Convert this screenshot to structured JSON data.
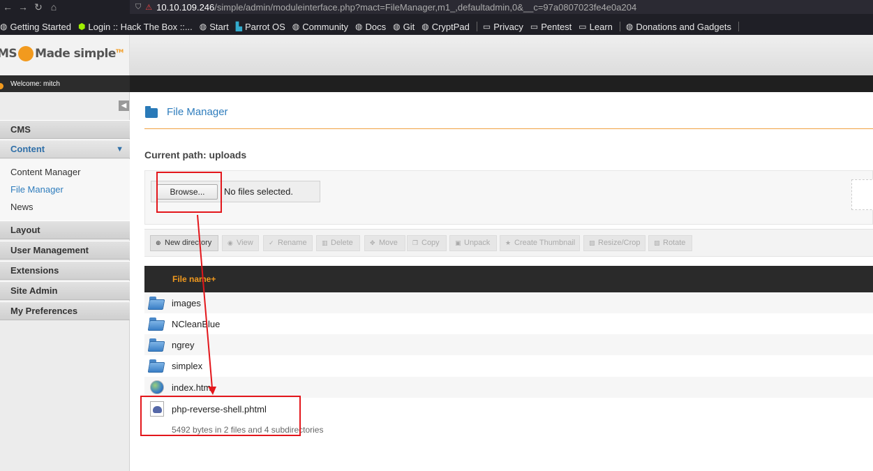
{
  "browser": {
    "url_host": "10.10.109.246",
    "url_path": "/simple/admin/moduleinterface.php?mact=FileManager,m1_,defaultadmin,0&__c=97a0807023fe4e0a204",
    "bookmarks": [
      {
        "label": "Getting Started",
        "icon": "globe-icon"
      },
      {
        "label": "Login :: Hack The Box ::...",
        "icon": "htb-cube-icon"
      },
      {
        "label": "Start",
        "icon": "globe-icon"
      },
      {
        "label": "Parrot OS",
        "icon": "parrot-icon"
      },
      {
        "label": "Community",
        "icon": "globe-icon"
      },
      {
        "label": "Docs",
        "icon": "globe-icon"
      },
      {
        "label": "Git",
        "icon": "globe-icon"
      },
      {
        "label": "CryptPad",
        "icon": "globe-icon"
      },
      {
        "label": "Privacy",
        "icon": "folder-icon"
      },
      {
        "label": "Pentest",
        "icon": "folder-icon"
      },
      {
        "label": "Learn",
        "icon": "folder-icon"
      },
      {
        "label": "Donations and Gadgets",
        "icon": "globe-icon"
      }
    ]
  },
  "header": {
    "logo_left": "MS",
    "logo_right": "Made simple",
    "tm": "TM",
    "welcome": "Welcome: mitch"
  },
  "sidebar": {
    "sections": [
      {
        "label": "CMS"
      },
      {
        "label": "Content"
      },
      {
        "label": "Layout"
      },
      {
        "label": "User Management"
      },
      {
        "label": "Extensions"
      },
      {
        "label": "Site Admin"
      },
      {
        "label": "My Preferences"
      }
    ],
    "content_items": [
      {
        "label": "Content Manager"
      },
      {
        "label": "File Manager"
      },
      {
        "label": "News"
      }
    ]
  },
  "main": {
    "title": "File Manager",
    "current_path": "Current path: uploads",
    "browse_label": "Browse...",
    "no_files": "No files selected.",
    "toolbar": [
      {
        "label": "New directory",
        "icon": "plus-circle-icon"
      },
      {
        "label": "View",
        "icon": "eye-icon"
      },
      {
        "label": "Rename",
        "icon": "check-icon"
      },
      {
        "label": "Delete",
        "icon": "trash-icon"
      },
      {
        "label": "Move",
        "icon": "move-icon"
      },
      {
        "label": "Copy",
        "icon": "copy-icon"
      },
      {
        "label": "Unpack",
        "icon": "unpack-icon"
      },
      {
        "label": "Create Thumbnail",
        "icon": "star-icon"
      },
      {
        "label": "Resize/Crop",
        "icon": "image-icon"
      },
      {
        "label": "Rotate",
        "icon": "rotate-icon"
      }
    ],
    "column_header": "File name+",
    "files": [
      {
        "name": "images",
        "type": "folder"
      },
      {
        "name": "NCleanBlue",
        "type": "folder"
      },
      {
        "name": "ngrey",
        "type": "folder"
      },
      {
        "name": "simplex",
        "type": "folder"
      },
      {
        "name": "index.html",
        "type": "html"
      },
      {
        "name": "php-reverse-shell.phtml",
        "type": "php"
      }
    ],
    "summary": "5492 bytes in 2 files and 4 subdirectories"
  },
  "colors": {
    "accent_orange": "#f29a1e",
    "link_blue": "#2f7dbd",
    "annotation_red": "#e3161b"
  }
}
